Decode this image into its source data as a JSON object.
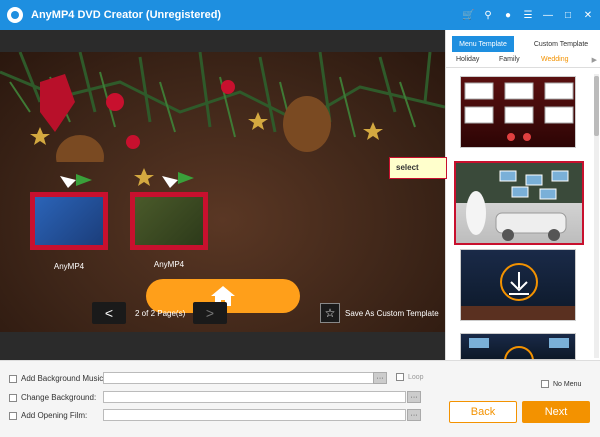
{
  "titlebar": {
    "title": "AnyMP4 DVD Creator (Unregistered)",
    "icons": [
      "cart-icon",
      "key-icon",
      "chat-icon",
      "menu-icon",
      "minimize-icon",
      "maximize-icon",
      "close-icon"
    ]
  },
  "preview": {
    "thumbs": [
      {
        "label": "AnyMP4"
      },
      {
        "label": "AnyMP4"
      }
    ],
    "pager": {
      "text": "2 of 2 Page(s)",
      "prev": "<",
      "next": ">"
    },
    "save_template": "Save As Custom Template"
  },
  "right_panel": {
    "tabs": [
      {
        "label": "Menu Template",
        "active": true
      },
      {
        "label": "Custom Template",
        "active": false
      }
    ],
    "categories": [
      {
        "label": "Holiday",
        "active": false
      },
      {
        "label": "Family",
        "active": false
      },
      {
        "label": "Wedding",
        "active": true
      }
    ],
    "tooltip": "select"
  },
  "bottom": {
    "options": [
      {
        "label": "Add Background Music:",
        "value": "",
        "dots": "···"
      },
      {
        "label": "Change Background:",
        "value": "",
        "dots": "···"
      },
      {
        "label": "Add Opening Film:",
        "value": "",
        "dots": "···"
      }
    ],
    "loop_label": "Loop",
    "no_menu_label": "No Menu",
    "back_label": "Back",
    "next_label": "Next"
  },
  "colors": {
    "brand_blue": "#1e8fe0",
    "accent_orange": "#f39200",
    "highlight_red": "#c8102e"
  }
}
